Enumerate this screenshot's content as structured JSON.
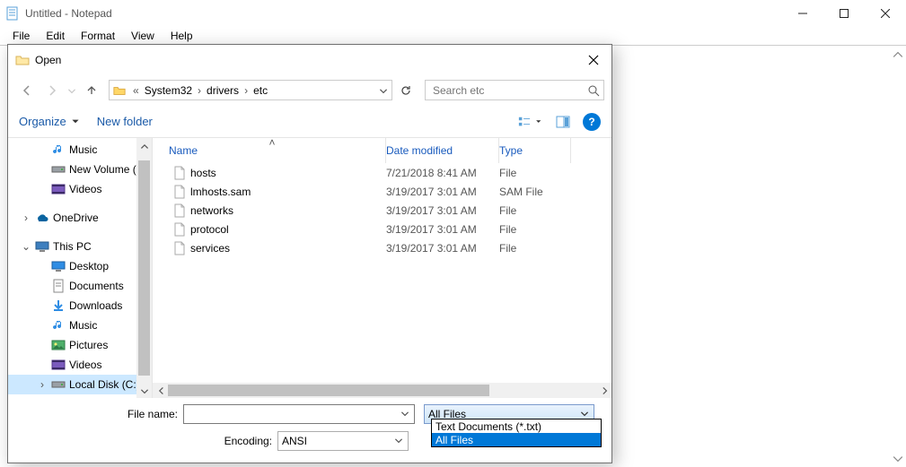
{
  "notepad": {
    "title": "Untitled - Notepad",
    "menu": [
      "File",
      "Edit",
      "Format",
      "View",
      "Help"
    ]
  },
  "dialog": {
    "title": "Open",
    "breadcrumb": {
      "prefix": "«",
      "parts": [
        "System32",
        "drivers",
        "etc"
      ]
    },
    "search_placeholder": "Search etc",
    "toolbar": {
      "organize": "Organize",
      "new_folder": "New folder"
    },
    "tree_top": [
      {
        "label": "Music",
        "icon": "music"
      },
      {
        "label": "New Volume (E:)",
        "icon": "drive"
      },
      {
        "label": "Videos",
        "icon": "videos"
      }
    ],
    "onedrive": "OneDrive",
    "thispc": "This PC",
    "tree_pc": [
      {
        "label": "Desktop",
        "icon": "desktop"
      },
      {
        "label": "Documents",
        "icon": "documents"
      },
      {
        "label": "Downloads",
        "icon": "downloads"
      },
      {
        "label": "Music",
        "icon": "music"
      },
      {
        "label": "Pictures",
        "icon": "pictures"
      },
      {
        "label": "Videos",
        "icon": "videos"
      },
      {
        "label": "Local Disk (C:)",
        "icon": "drive",
        "selected": true
      }
    ],
    "columns": {
      "name": "Name",
      "date": "Date modified",
      "type": "Type"
    },
    "files": [
      {
        "name": "hosts",
        "date": "7/21/2018 8:41 AM",
        "type": "File"
      },
      {
        "name": "lmhosts.sam",
        "date": "3/19/2017 3:01 AM",
        "type": "SAM File"
      },
      {
        "name": "networks",
        "date": "3/19/2017 3:01 AM",
        "type": "File"
      },
      {
        "name": "protocol",
        "date": "3/19/2017 3:01 AM",
        "type": "File"
      },
      {
        "name": "services",
        "date": "3/19/2017 3:01 AM",
        "type": "File"
      }
    ],
    "filename_label": "File name:",
    "filename_value": "",
    "encoding_label": "Encoding:",
    "encoding_value": "ANSI",
    "filetype_value": "All Files",
    "filetype_options": [
      "Text Documents (*.txt)",
      "All Files"
    ]
  }
}
